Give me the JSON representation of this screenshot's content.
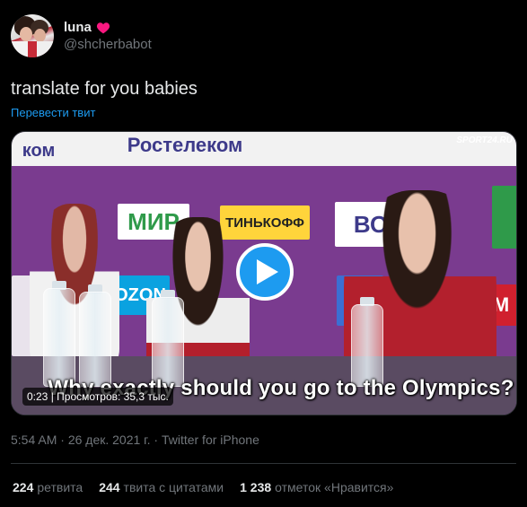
{
  "user": {
    "display_name": "luna",
    "handle": "@shcherbabot",
    "heart_icon": "heart-icon",
    "heart_color": "#f91880"
  },
  "tweet": {
    "text": "translate for you babies",
    "translate_label": "Перевести твит"
  },
  "media": {
    "subtitle": "Why exactly should you go to the Olympics?",
    "views": "0:23 | Просмотров: 35,3 тыс.",
    "watermark": "SPORT24.RU",
    "sponsors": [
      "Ростелеком",
      "МИР",
      "ТИНЬКОФФ",
      "OZON",
      "BOSCO"
    ],
    "accent": "#1d9bf0"
  },
  "meta": {
    "time": "5:54 AM",
    "sep": " · ",
    "date": "26 дек. 2021 г.",
    "source": "Twitter for iPhone"
  },
  "stats": [
    {
      "num": "224",
      "label": "ретвита"
    },
    {
      "num": "244",
      "label": "твита с цитатами"
    },
    {
      "num": "1 238",
      "label": "отметок «Нравится»"
    }
  ]
}
